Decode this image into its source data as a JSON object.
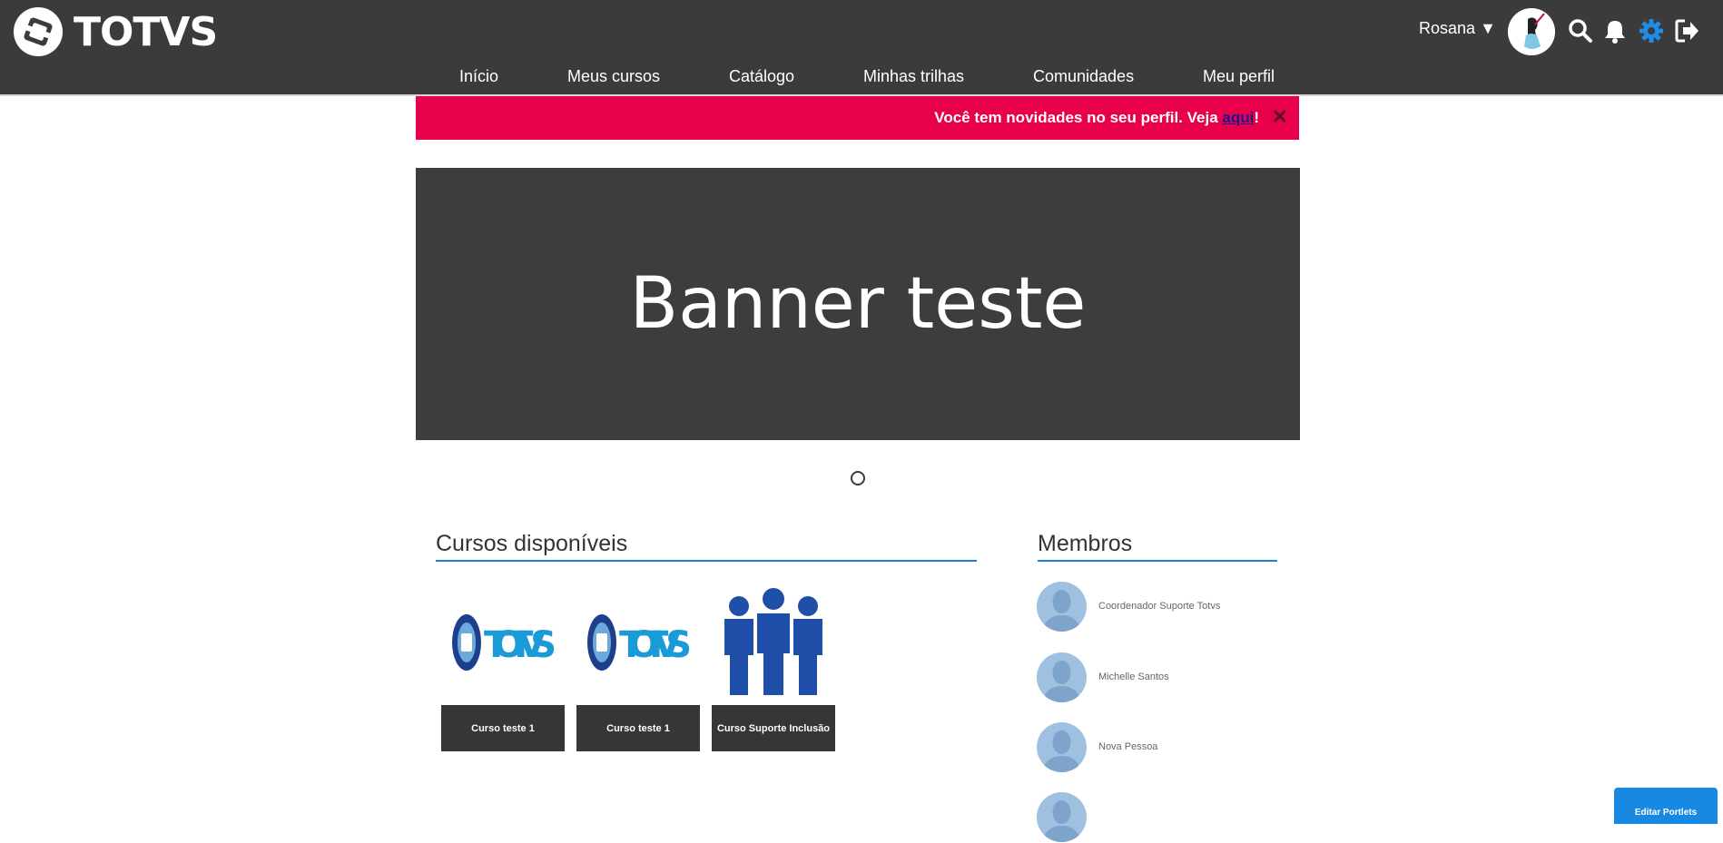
{
  "brand": {
    "name": "TOTVS"
  },
  "header": {
    "user_name": "Rosana",
    "user_caret": "▼",
    "icons": [
      "search-icon",
      "bell-icon",
      "gear-icon",
      "logout-icon"
    ],
    "gear_color": "#1f8ce6"
  },
  "nav": {
    "items": [
      {
        "label": "Início"
      },
      {
        "label": "Meus cursos"
      },
      {
        "label": "Catálogo"
      },
      {
        "label": "Minhas trilhas"
      },
      {
        "label": "Comunidades"
      },
      {
        "label": "Meu perfil"
      }
    ]
  },
  "notice": {
    "text": "Você tem novidades no seu perfil. Veja ",
    "link": "aqui",
    "suffix": "!",
    "close": "✕",
    "color": "#e8004a"
  },
  "banner": {
    "title": "Banner teste"
  },
  "courses": {
    "title": "Cursos disponíveis",
    "items": [
      {
        "label": "Curso teste 1",
        "image": "totvs-logo-icon"
      },
      {
        "label": "Curso teste 1",
        "image": "totvs-logo-icon"
      },
      {
        "label": "Curso Suporte Inclusão",
        "image": "people-group-icon"
      }
    ]
  },
  "members": {
    "title": "Membros",
    "items": [
      {
        "name": "Coordenador Suporte Totvs"
      },
      {
        "name": "Michelle Santos"
      },
      {
        "name": "Nova Pessoa"
      },
      {
        "name": ""
      }
    ]
  },
  "edit_portlets": {
    "label": "Editar Portlets"
  },
  "colors": {
    "topbar": "#3b3b3b",
    "accent": "#1f7fd6",
    "banner": "#3d3d3d"
  }
}
